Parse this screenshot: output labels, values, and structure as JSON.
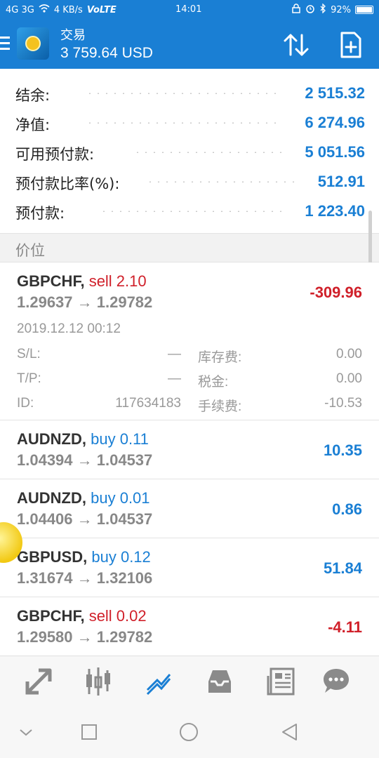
{
  "status_bar": {
    "signal": "4G 3G",
    "speed": "4 KB/s",
    "network": "VoLTE",
    "time": "14:01",
    "battery": "92%",
    "battery_level": 0.92
  },
  "header": {
    "title": "交易",
    "balance_line": "3 759.64 USD"
  },
  "summary": {
    "rows": [
      {
        "label": "结余:",
        "value": "2 515.32"
      },
      {
        "label": "净值:",
        "value": "6 274.96"
      },
      {
        "label": "可用预付款:",
        "value": "5 051.56"
      },
      {
        "label": "预付款比率(%):",
        "value": "512.91"
      },
      {
        "label": "预付款:",
        "value": "1 223.40"
      }
    ]
  },
  "section_title": "价位",
  "positions": [
    {
      "symbol": "GBPCHF,",
      "direction": "sell 2.10",
      "side": "sell",
      "prices": "1.29637 → 1.29782",
      "profit": "-309.96",
      "details": {
        "date": "2019.12.12 00:12",
        "sl_label": "S/L:",
        "sl_value": "—",
        "tp_label": "T/P:",
        "tp_value": "—",
        "id_label": "ID:",
        "id_value": "117634183",
        "swap_label": "库存费:",
        "swap_value": "0.00",
        "tax_label": "税金:",
        "tax_value": "0.00",
        "fee_label": "手续费:",
        "fee_value": "-10.53"
      }
    },
    {
      "symbol": "AUDNZD,",
      "direction": "buy 0.11",
      "side": "buy",
      "prices": "1.04394 → 1.04537",
      "profit": "10.35"
    },
    {
      "symbol": "AUDNZD,",
      "direction": "buy 0.01",
      "side": "buy",
      "prices": "1.04406 → 1.04537",
      "profit": "0.86"
    },
    {
      "symbol": "GBPUSD,",
      "direction": "buy 0.12",
      "side": "buy",
      "prices": "1.31674 → 1.32106",
      "profit": "51.84"
    },
    {
      "symbol": "GBPCHF,",
      "direction": "sell 0.02",
      "side": "sell",
      "prices": "1.29580 → 1.29782",
      "profit": "-4.11"
    }
  ],
  "bottom_nav": [
    {
      "icon": "trade-arrows-icon",
      "active": false
    },
    {
      "icon": "candlestick-chart-icon",
      "active": false
    },
    {
      "icon": "trend-chart-icon",
      "active": true
    },
    {
      "icon": "inbox-icon",
      "active": false
    },
    {
      "icon": "news-icon",
      "active": false
    },
    {
      "icon": "chat-icon",
      "active": false
    }
  ],
  "colors": {
    "accent": "#1a7fd4",
    "sell": "#d0202a",
    "buy": "#1a7fd4"
  }
}
